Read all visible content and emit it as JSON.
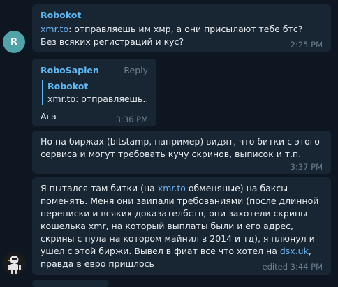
{
  "messages": [
    {
      "sender": "Robokot",
      "text_parts": [
        "xmr.to",
        ": отправляешь им хмр, а они присылают тебе бтс? Без всяких регистраций и кус?"
      ],
      "time": "2:25 PM",
      "avatar_letter": "R"
    },
    {
      "sender": "RoboSapien",
      "reply_label": "Reply",
      "quote_author": "Robokot",
      "quote_text": "xmr.to: отправляешь...",
      "text": "Ага",
      "time": "3:36 PM"
    },
    {
      "text": "Но на биржах (bitstamp, например) видят, что битки с этого сервиса и могут требовать кучу скринов, выписок и т.п.",
      "time": "3:37 PM"
    },
    {
      "text_parts": [
        "Я пытался там битки (на ",
        "xmr.to",
        " обменяные) на баксы поменять. Меня они заипали требованиями (после длинной переписки и всяких доказателбств, они захотели скрины кошелька xmr, на который выплаты были и его адрес, скрины с пула на котором майнил в 2014 и тд), я плюнул и ушел с этой биржи. Вывел в фиат все что хотел на ",
        "dsx.uk",
        ", правда в евро пришлось"
      ],
      "time": "edited 3:44 PM"
    }
  ],
  "colors": {
    "background": "#0e1621",
    "bubble": "#182533",
    "sender_name": "#5fb8f2",
    "link": "#6ab3f3",
    "meta": "#6d7f8f",
    "avatar_r": "#4fa3a9"
  },
  "icons": {
    "robot_avatar": "robot-avatar-icon"
  }
}
